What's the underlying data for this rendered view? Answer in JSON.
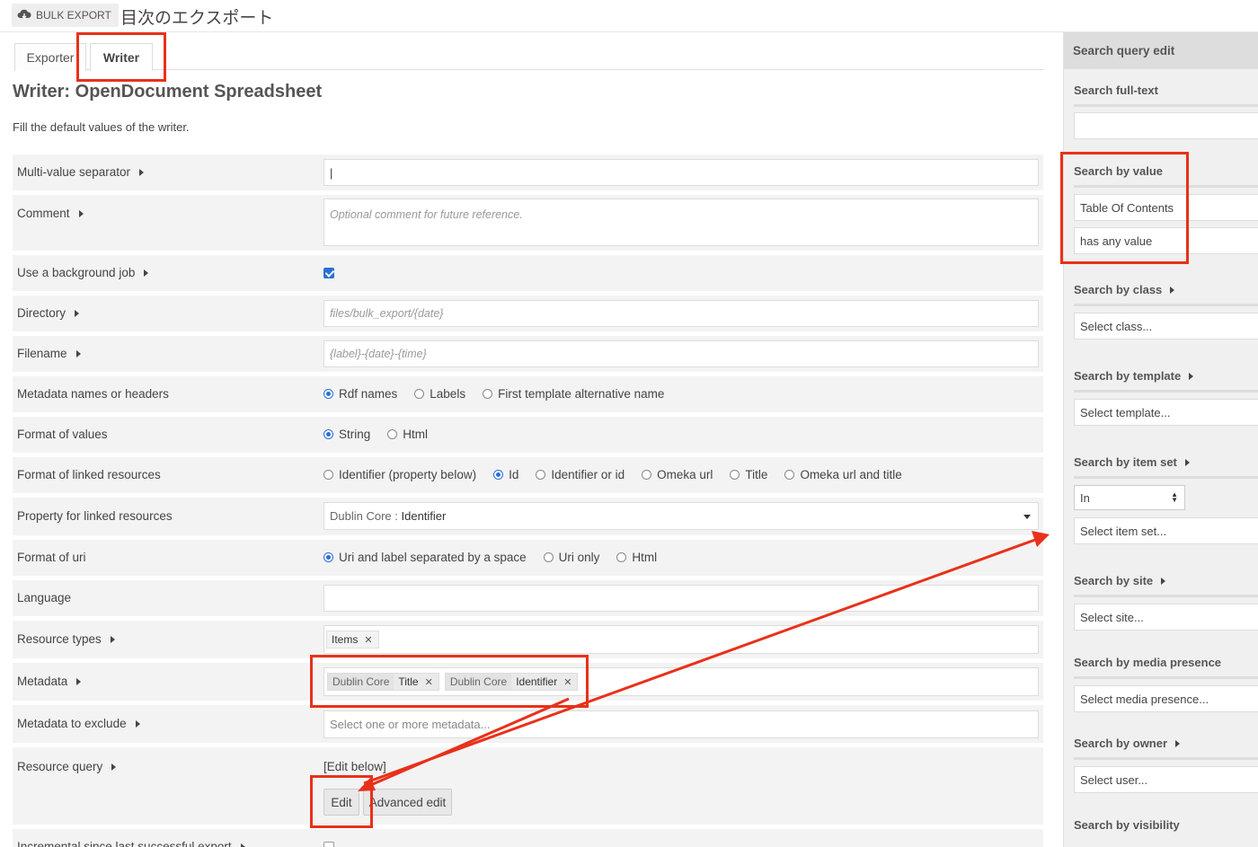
{
  "header": {
    "bulk_export_label": "BULK EXPORT",
    "page_title": "目次のエクスポート"
  },
  "tabs": [
    {
      "label": "Exporter"
    },
    {
      "label": "Writer"
    }
  ],
  "writer": {
    "heading": "Writer: OpenDocument Spreadsheet",
    "description": "Fill the default values of the writer."
  },
  "form": {
    "multi_value_separator": {
      "label": "Multi-value separator",
      "value": "|"
    },
    "comment": {
      "label": "Comment",
      "placeholder": "Optional comment for future reference."
    },
    "background_job": {
      "label": "Use a background job",
      "checked": true
    },
    "directory": {
      "label": "Directory",
      "placeholder": "files/bulk_export/{date}"
    },
    "filename": {
      "label": "Filename",
      "placeholder": "{label}-{date}-{time}"
    },
    "metadata_names": {
      "label": "Metadata names or headers",
      "options": [
        "Rdf names",
        "Labels",
        "First template alternative name"
      ],
      "selected": 0
    },
    "format_values": {
      "label": "Format of values",
      "options": [
        "String",
        "Html"
      ],
      "selected": 0
    },
    "format_linked": {
      "label": "Format of linked resources",
      "options": [
        "Identifier (property below)",
        "Id",
        "Identifier or id",
        "Omeka url",
        "Title",
        "Omeka url and title"
      ],
      "selected": 1
    },
    "property_linked": {
      "label": "Property for linked resources",
      "vocab": "Dublin Core",
      "term": "Identifier"
    },
    "format_uri": {
      "label": "Format of uri",
      "options": [
        "Uri and label separated by a space",
        "Uri only",
        "Html"
      ],
      "selected": 0
    },
    "language": {
      "label": "Language",
      "value": ""
    },
    "resource_types": {
      "label": "Resource types",
      "chips": [
        "Items"
      ]
    },
    "metadata": {
      "label": "Metadata",
      "chips": [
        {
          "vocab": "Dublin Core",
          "term": "Title"
        },
        {
          "vocab": "Dublin Core",
          "term": "Identifier"
        }
      ]
    },
    "metadata_exclude": {
      "label": "Metadata to exclude",
      "placeholder": "Select one or more metadata..."
    },
    "resource_query": {
      "label": "Resource query",
      "value": "[Edit below]",
      "edit_label": "Edit",
      "advanced_label": "Advanced edit"
    },
    "incremental": {
      "label": "Incremental since last successful export",
      "checked": false
    }
  },
  "sidebar": {
    "header": "Search query edit",
    "fulltext_label": "Search full-text",
    "fulltext_value": "",
    "by_value_label": "Search by value",
    "by_value_property": "Table Of Contents",
    "by_value_type": "has any value",
    "by_class_label": "Search by class",
    "by_class_placeholder": "Select class...",
    "by_template_label": "Search by template",
    "by_template_placeholder": "Select template...",
    "by_itemset_label": "Search by item set",
    "by_itemset_op": "In",
    "by_itemset_placeholder": "Select item set...",
    "by_site_label": "Search by site",
    "by_site_placeholder": "Select site...",
    "by_media_label": "Search by media presence",
    "by_media_placeholder": "Select media presence...",
    "by_owner_label": "Search by owner",
    "by_owner_placeholder": "Select user...",
    "by_visibility_label": "Search by visibility"
  },
  "colors": {
    "annotation": "#e8311a",
    "accent": "#2a6fd6"
  }
}
